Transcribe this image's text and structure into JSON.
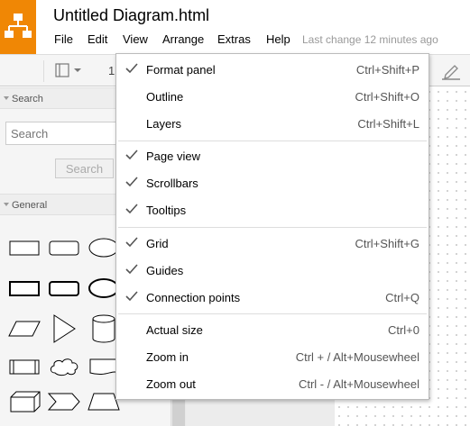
{
  "header": {
    "title": "Untitled Diagram.html",
    "last_change": "Last change 12 minutes ago",
    "logo_color": "#f08705"
  },
  "menubar": {
    "file": "File",
    "edit": "Edit",
    "view": "View",
    "arrange": "Arrange",
    "extras": "Extras",
    "help": "Help"
  },
  "toolbar": {
    "zoom_partial": "1",
    "panel_icon": "panel-layout-icon",
    "edit_icon": "pencil-icon"
  },
  "sidebar": {
    "search_section": "Search",
    "search_placeholder": "Search",
    "search_button": "Search",
    "general_section": "General"
  },
  "view_menu": {
    "items": [
      {
        "label": "Format panel",
        "shortcut": "Ctrl+Shift+P",
        "checked": true
      },
      {
        "label": "Outline",
        "shortcut": "Ctrl+Shift+O",
        "checked": false
      },
      {
        "label": "Layers",
        "shortcut": "Ctrl+Shift+L",
        "checked": false
      },
      {
        "label": "Page view",
        "shortcut": "",
        "checked": true
      },
      {
        "label": "Scrollbars",
        "shortcut": "",
        "checked": true
      },
      {
        "label": "Tooltips",
        "shortcut": "",
        "checked": true
      },
      {
        "label": "Grid",
        "shortcut": "Ctrl+Shift+G",
        "checked": true
      },
      {
        "label": "Guides",
        "shortcut": "",
        "checked": true
      },
      {
        "label": "Connection points",
        "shortcut": "Ctrl+Q",
        "checked": true
      },
      {
        "label": "Actual size",
        "shortcut": "Ctrl+0",
        "checked": false
      },
      {
        "label": "Zoom in",
        "shortcut": "Ctrl + / Alt+Mousewheel",
        "checked": false
      },
      {
        "label": "Zoom out",
        "shortcut": "Ctrl - / Alt+Mousewheel",
        "checked": false
      }
    ]
  }
}
